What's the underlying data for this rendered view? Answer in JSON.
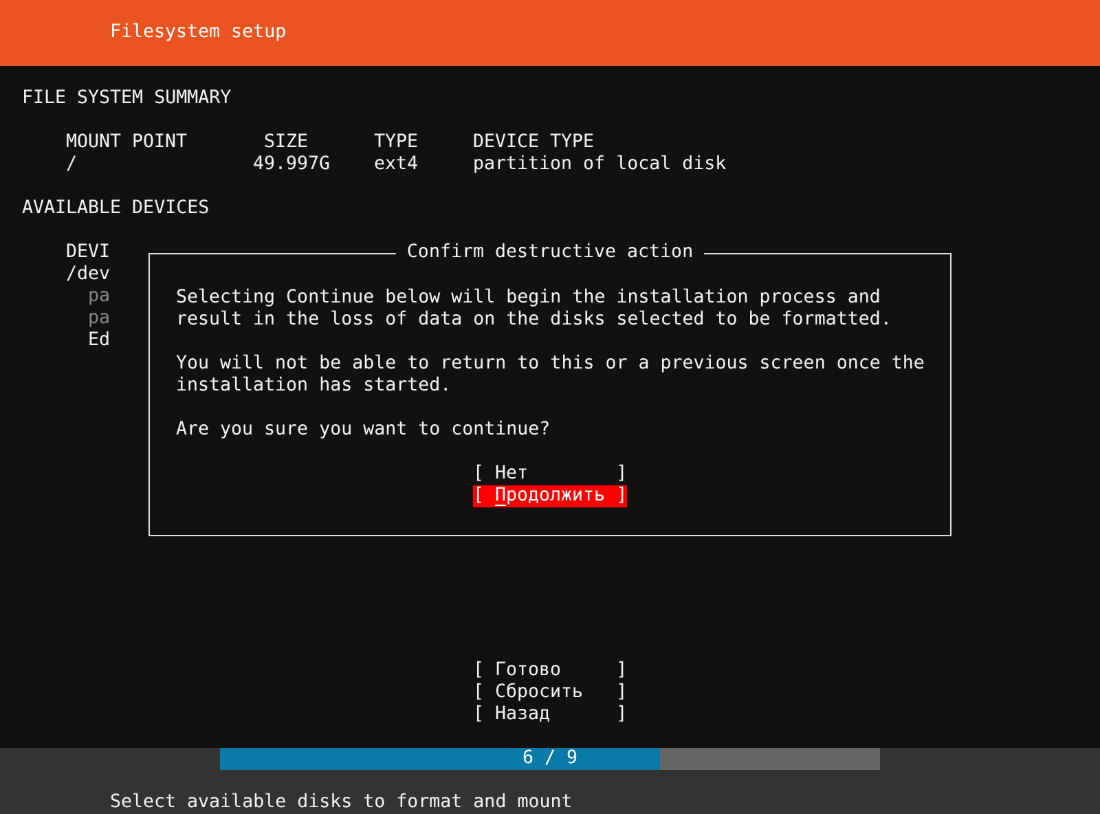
{
  "header": {
    "title": "Filesystem setup"
  },
  "summary": {
    "title": "FILE SYSTEM SUMMARY",
    "columns": [
      "MOUNT POINT",
      "SIZE",
      "TYPE",
      "DEVICE TYPE"
    ],
    "rows": [
      [
        "/",
        "49.997G",
        "ext4",
        "partition of local disk"
      ]
    ]
  },
  "devices": {
    "title": "AVAILABLE DEVICES",
    "column_1": "DEVI",
    "items": [
      {
        "text": "/dev",
        "children": [
          {
            "text": "pa",
            "disabled": true
          },
          {
            "text": "pa",
            "disabled": true
          },
          {
            "text": "Ed",
            "disabled": false
          }
        ]
      }
    ]
  },
  "dialog": {
    "title": "Confirm destructive action",
    "paragraphs": [
      [
        "Selecting Continue below will begin the installation process and",
        "result in the loss of data on the disks selected to be formatted."
      ],
      [
        "You will not be able to return to this or a previous screen once the",
        "installation has started."
      ],
      [
        "Are you sure you want to continue?"
      ]
    ],
    "buttons": [
      {
        "label": "[ Нет        ]",
        "selected": false
      },
      {
        "label": "[ Продолжить ]",
        "selected": true
      }
    ]
  },
  "buttons": [
    {
      "label": "[ Готово     ]",
      "selected": false
    },
    {
      "label": "[ Сбросить   ]",
      "selected": false
    },
    {
      "label": "[ Назад      ]",
      "selected": false
    }
  ],
  "progress": {
    "label": "6 / 9",
    "level": 0.667
  },
  "footer": "Select available disks to format and mount"
}
